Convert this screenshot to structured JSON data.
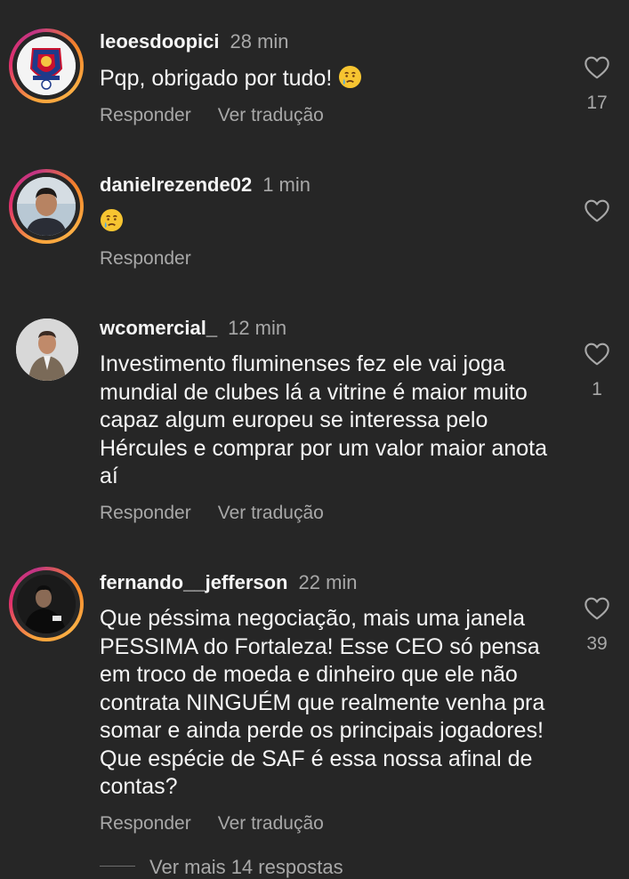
{
  "comments": [
    {
      "username": "leoesdoopici",
      "time": "28 min",
      "text": "Pqp, obrigado por tudo!",
      "emoji": "crying-face",
      "reply_label": "Responder",
      "translate_label": "Ver tradução",
      "likes": "17"
    },
    {
      "username": "danielrezende02",
      "time": "1 min",
      "emoji": "crying-face",
      "reply_label": "Responder"
    },
    {
      "username": "wcomercial_",
      "time": "12 min",
      "text": "Investimento fluminenses fez ele vai joga mundial de clubes lá a vitrine é maior muito capaz algum europeu se interessa pelo Hércules e comprar por um valor maior anota aí",
      "reply_label": "Responder",
      "translate_label": "Ver tradução",
      "likes": "1"
    },
    {
      "username": "fernando__jefferson",
      "time": "22 min",
      "text": "Que péssima negociação, mais uma janela PESSIMA do Fortaleza! Esse CEO só pensa em troco de moeda e dinheiro que ele não contrata NINGUÉM que realmente venha pra somar e ainda perde os principais jogadores! Que espécie de SAF é essa nossa afinal de contas?",
      "reply_label": "Responder",
      "translate_label": "Ver tradução",
      "likes": "39"
    }
  ],
  "more_replies_label": "Ver mais 14 respostas",
  "icons": {
    "like": "heart-outline-icon",
    "emoji": "crying-face-emoji"
  },
  "colors": {
    "background": "#262626",
    "text": "#f5f5f5",
    "secondary": "#a8a8a8",
    "ring_start": "#f9a33b",
    "ring_end": "#c13584"
  }
}
